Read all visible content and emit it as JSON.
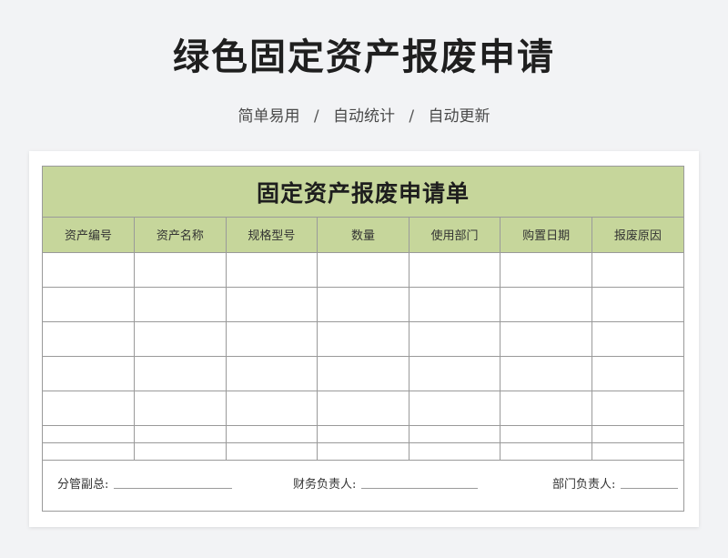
{
  "header": {
    "title": "绿色固定资产报废申请",
    "subtitle": [
      "简单易用",
      "自动统计",
      "自动更新"
    ],
    "separator": "/"
  },
  "form": {
    "title": "固定资产报废申请单",
    "columns": [
      "资产编号",
      "资产名称",
      "规格型号",
      "数量",
      "使用部门",
      "购置日期",
      "报废原因"
    ],
    "empty_rows": 6,
    "signatures": [
      "分管副总:",
      "财务负责人:",
      "部门负责人:"
    ]
  },
  "colors": {
    "accent_green": "#c6d69b",
    "background": "#f2f3f5",
    "border": "#9a9a9a"
  }
}
